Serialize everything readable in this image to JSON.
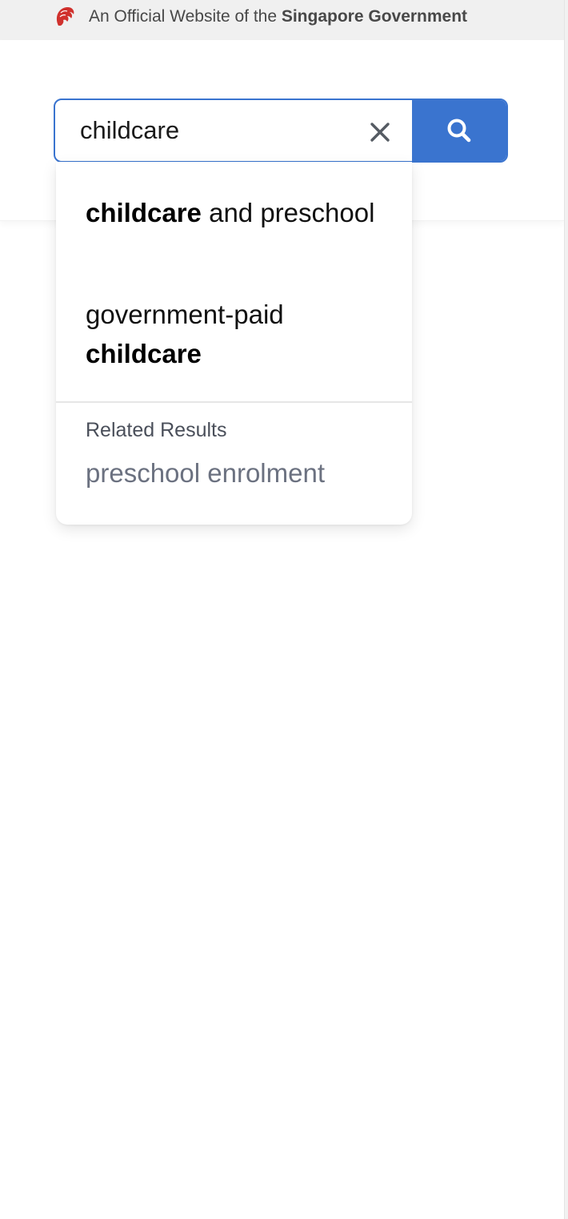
{
  "masthead": {
    "prefix": "An Official Website of the ",
    "emphasis": "Singapore Government",
    "logo_icon": "lion-head-icon",
    "logo_color": "#d0312d"
  },
  "search": {
    "value": "childcare",
    "clear_icon": "close-icon",
    "submit_icon": "search-icon",
    "accent_color": "#3a74cf"
  },
  "suggestions": [
    {
      "bold": "childcare",
      "after": " and preschool"
    },
    {
      "before": "government-paid ",
      "bold": "childcare"
    }
  ],
  "related": {
    "heading": "Related Results",
    "items": [
      "preschool enrolment"
    ]
  }
}
